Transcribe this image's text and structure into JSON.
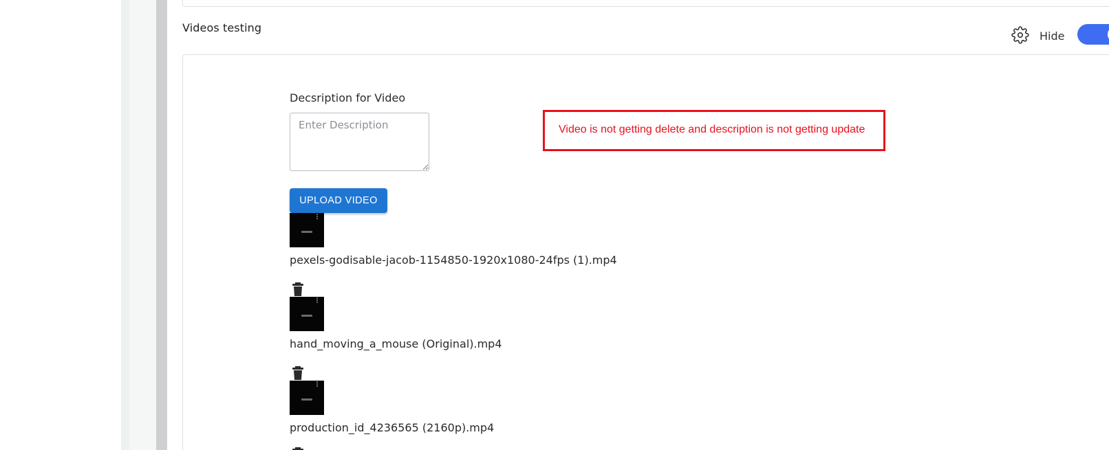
{
  "section": {
    "title": "Videos testing",
    "settings_icon": "gear-icon",
    "visibility_label": "Hide",
    "toggle_on": true,
    "accent_color": "#3f6df1"
  },
  "description": {
    "label": "Decsription for Video",
    "placeholder": "Enter Description",
    "value": ""
  },
  "annotation": {
    "text": "Video is not getting delete and description is not getting update",
    "color": "#e8101b"
  },
  "upload": {
    "label": "UPLOAD VIDEO",
    "color": "#1f76d2"
  },
  "videos": [
    {
      "name": "pexels-godisable-jacob-1154850-1920x1080-24fps (1).mp4"
    },
    {
      "name": "hand_moving_a_mouse (Original).mp4",
      "delete_icon": "trash-icon"
    },
    {
      "name": "production_id_4236565 (2160p).mp4",
      "delete_icon": "trash-icon"
    }
  ]
}
